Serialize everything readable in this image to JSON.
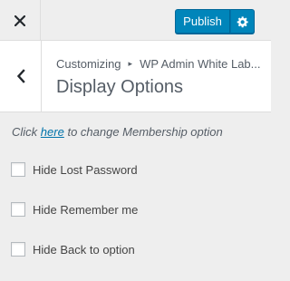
{
  "header": {
    "publish_label": "Publish"
  },
  "section": {
    "breadcrumb_root": "Customizing",
    "breadcrumb_separator": "▸",
    "breadcrumb_current": "WP Admin White Lab...",
    "title": "Display Options"
  },
  "note": {
    "prefix": "Click",
    "link_text": "here",
    "suffix": "to change Membership option"
  },
  "options": [
    {
      "label": "Hide Lost Password",
      "checked": false
    },
    {
      "label": "Hide Remember me",
      "checked": false
    },
    {
      "label": "Hide Back to option",
      "checked": false
    }
  ],
  "colors": {
    "accent": "#0085ba",
    "link": "#0073aa",
    "panel_bg": "#eeeeee"
  }
}
